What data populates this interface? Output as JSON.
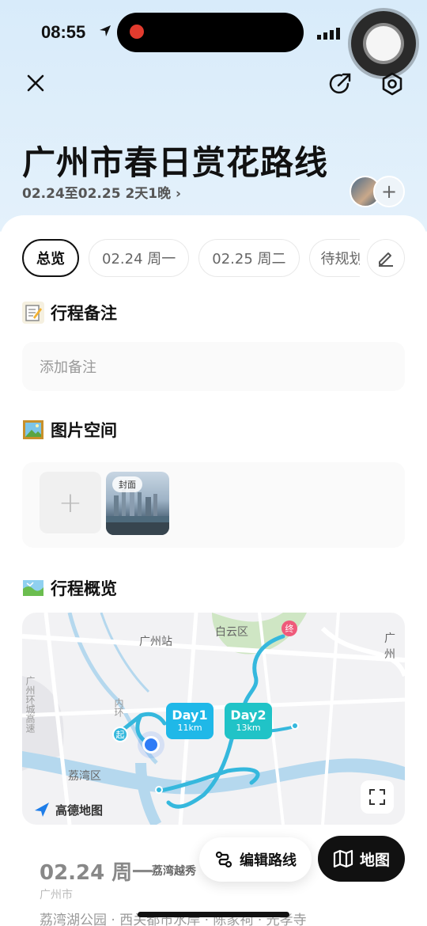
{
  "status": {
    "time": "08:55"
  },
  "trip": {
    "title": "广州市春日赏花路线",
    "dates": "02.24至02.25 2天1晚",
    "add_member": "+"
  },
  "tabs": [
    {
      "label": "总览"
    },
    {
      "label": "02.24 周一"
    },
    {
      "label": "02.25 周二"
    },
    {
      "label": "待规划"
    }
  ],
  "notes": {
    "title": "行程备注",
    "placeholder": "添加备注"
  },
  "photos": {
    "title": "图片空间",
    "add": "+",
    "cover_tag": "封面"
  },
  "overview": {
    "title": "行程概览",
    "map_labels": {
      "guangzhou_station": "广州站",
      "baiyun": "白云区",
      "guangzhou": "广州",
      "liwan": "荔湾区",
      "inner_ring": "内环",
      "ring_road": "广州环城高速",
      "start": "起",
      "end": "终"
    },
    "days": [
      {
        "label": "Day1",
        "dist": "11km",
        "color": "#1fb8e8"
      },
      {
        "label": "Day2",
        "dist": "13km",
        "color": "#20c3c7"
      }
    ],
    "provider": "高德地图"
  },
  "day_detail": {
    "title": "02.24 周一",
    "area": "荔湾越秀",
    "city": "广州市",
    "places": "荔湾湖公园 · 西关都市水岸 · 陈家祠 · 光孝寺"
  },
  "fab": {
    "edit_route": "编辑路线",
    "map": "地图"
  }
}
